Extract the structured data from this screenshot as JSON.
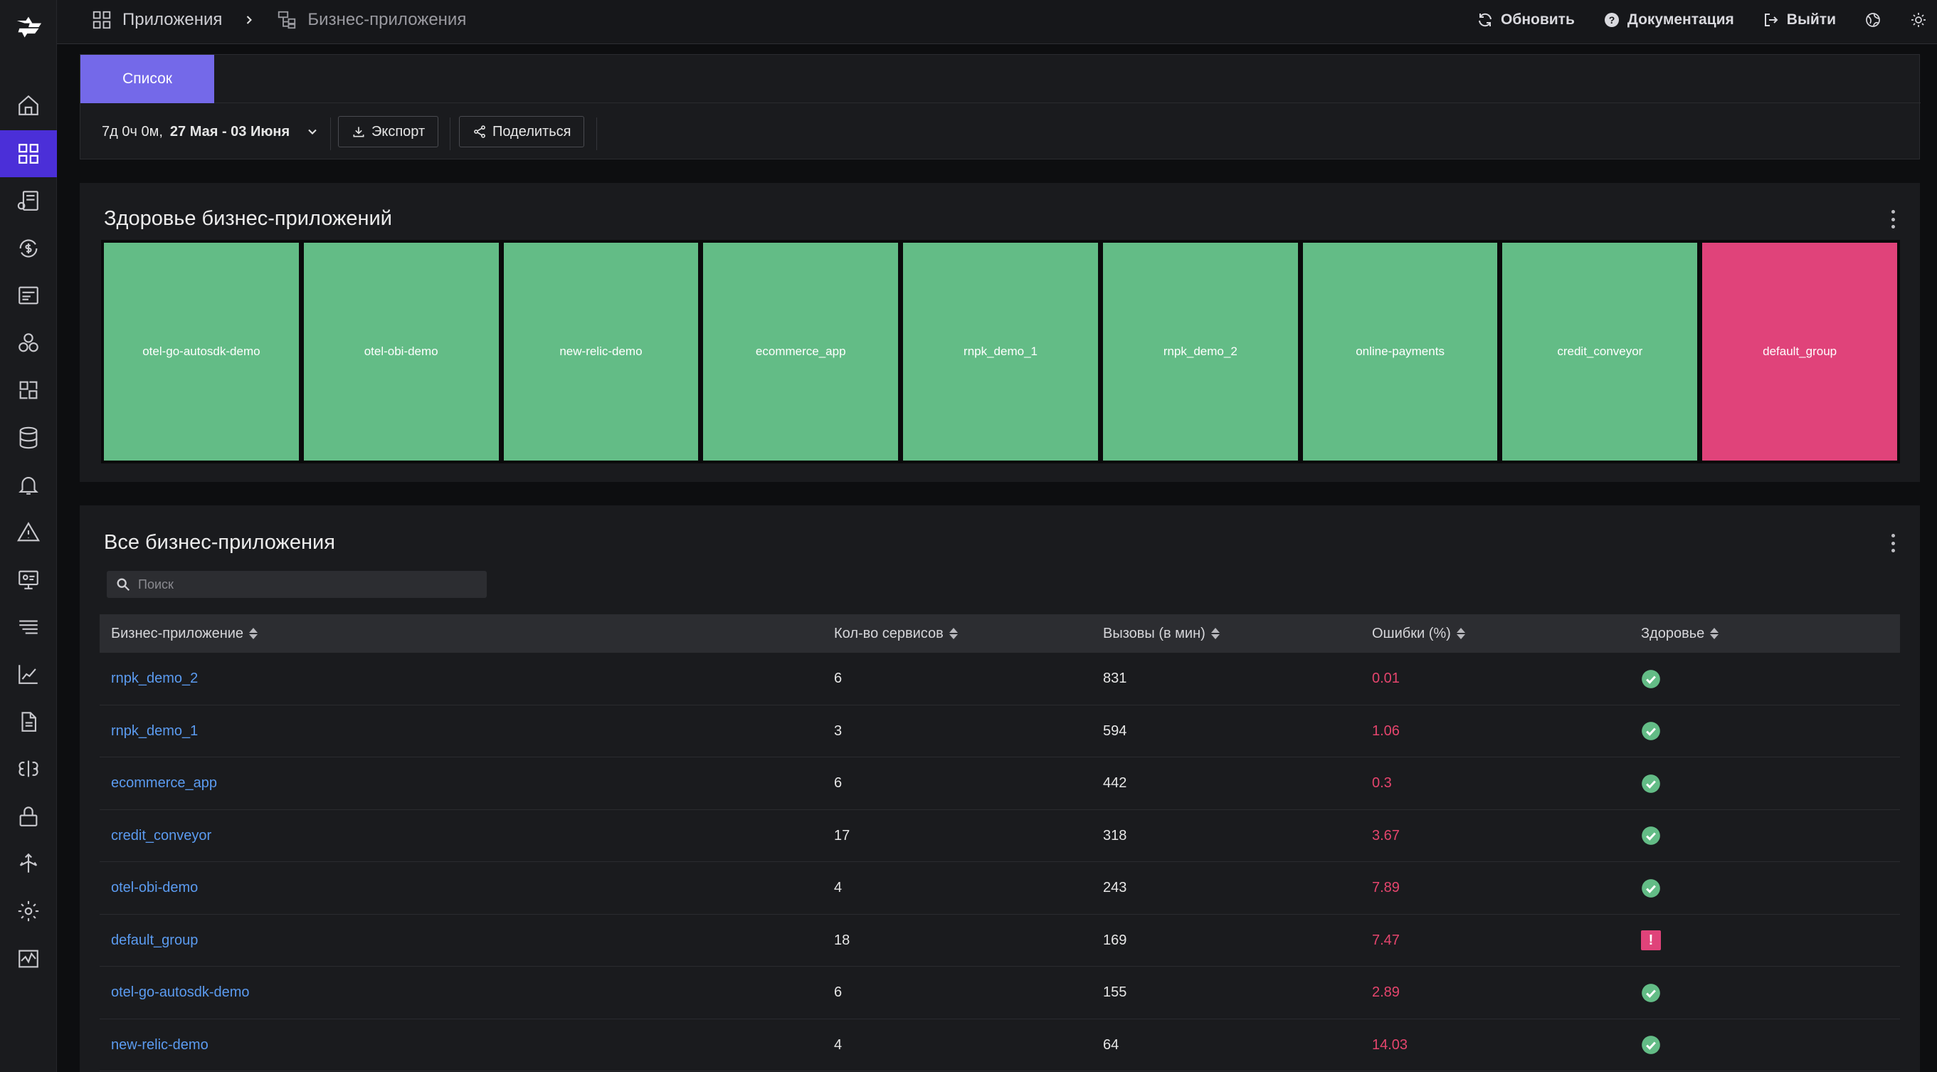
{
  "breadcrumb": {
    "item1": "Приложения",
    "item2": "Бизнес-приложения"
  },
  "top_actions": {
    "refresh": "Обновить",
    "docs": "Документация",
    "logout": "Выйти"
  },
  "tabs": [
    {
      "label": "Список",
      "active": true
    }
  ],
  "controls": {
    "range_duration": "7д 0ч 0м,",
    "range_dates": "27 Мая - 03 Июня",
    "export_label": "Экспорт",
    "share_label": "Поделиться"
  },
  "health_panel": {
    "title": "Здоровье бизнес-приложений",
    "tiles": [
      {
        "name": "otel-go-autosdk-demo",
        "status": "healthy"
      },
      {
        "name": "otel-obi-demo",
        "status": "healthy"
      },
      {
        "name": "new-relic-demo",
        "status": "healthy"
      },
      {
        "name": "ecommerce_app",
        "status": "healthy"
      },
      {
        "name": "rnpk_demo_1",
        "status": "healthy"
      },
      {
        "name": "rnpk_demo_2",
        "status": "healthy"
      },
      {
        "name": "online-payments",
        "status": "healthy"
      },
      {
        "name": "credit_conveyor",
        "status": "healthy"
      },
      {
        "name": "default_group",
        "status": "critical"
      }
    ]
  },
  "table_panel": {
    "title": "Все бизнес-приложения",
    "search_placeholder": "Поиск",
    "columns": [
      "Бизнес-приложение",
      "Кол-во сервисов",
      "Вызовы (в мин)",
      "Ошибки (%)",
      "Здоровье"
    ],
    "rows": [
      {
        "name": "rnpk_demo_2",
        "services": "6",
        "calls": "831",
        "errors": "0.01",
        "health": "ok"
      },
      {
        "name": "rnpk_demo_1",
        "services": "3",
        "calls": "594",
        "errors": "1.06",
        "health": "ok"
      },
      {
        "name": "ecommerce_app",
        "services": "6",
        "calls": "442",
        "errors": "0.3",
        "health": "ok"
      },
      {
        "name": "credit_conveyor",
        "services": "17",
        "calls": "318",
        "errors": "3.67",
        "health": "ok"
      },
      {
        "name": "otel-obi-demo",
        "services": "4",
        "calls": "243",
        "errors": "7.89",
        "health": "ok"
      },
      {
        "name": "default_group",
        "services": "18",
        "calls": "169",
        "errors": "7.47",
        "health": "critical"
      },
      {
        "name": "otel-go-autosdk-demo",
        "services": "6",
        "calls": "155",
        "errors": "2.89",
        "health": "ok"
      },
      {
        "name": "new-relic-demo",
        "services": "4",
        "calls": "64",
        "errors": "14.03",
        "health": "ok"
      }
    ],
    "critical_glyph": "!"
  },
  "colors": {
    "accent": "#4b2fd8",
    "tab_active": "#7469e9",
    "healthy": "#63bc86",
    "critical": "#e0437a",
    "link": "#5b9bf0",
    "error_text": "#e5456d"
  },
  "icons": {
    "sidebar": [
      "home-icon",
      "grid-icon",
      "services-icon",
      "dollar-sync-icon",
      "list-icon",
      "circles-icon",
      "puzzle-icon",
      "database-icon",
      "bell-icon",
      "warning-icon",
      "monitor-settings-icon",
      "layers-icon",
      "scatter-chart-icon",
      "document-icon",
      "brain-icon",
      "lock-icon",
      "arrows-icon",
      "gear-icon",
      "activity-icon"
    ]
  }
}
